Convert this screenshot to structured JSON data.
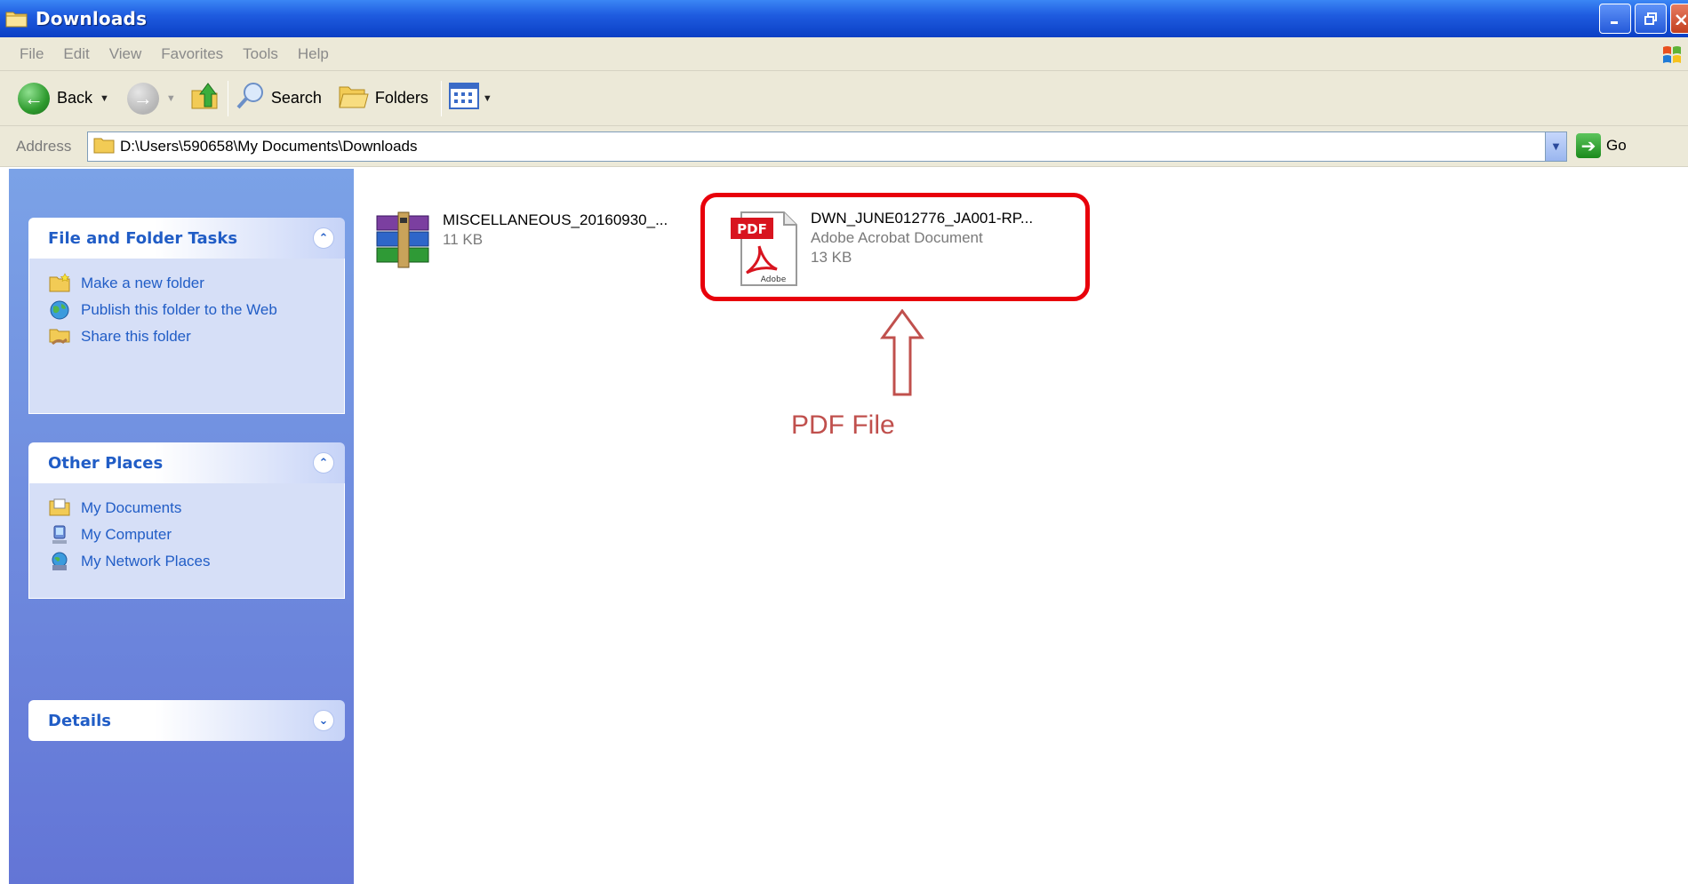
{
  "window": {
    "title": "Downloads"
  },
  "menu": [
    "File",
    "Edit",
    "View",
    "Favorites",
    "Tools",
    "Help"
  ],
  "toolbar": {
    "back_label": "Back",
    "search_label": "Search",
    "folders_label": "Folders"
  },
  "address": {
    "label": "Address",
    "path": "D:\\Users\\590658\\My Documents\\Downloads",
    "go_label": "Go"
  },
  "sidebar": {
    "file_tasks": {
      "title": "File and Folder Tasks",
      "items": [
        "Make a new folder",
        "Publish this folder to the Web",
        "Share this folder"
      ]
    },
    "other_places": {
      "title": "Other Places",
      "items": [
        "My Documents",
        "My Computer",
        "My Network Places"
      ]
    },
    "details": {
      "title": "Details"
    }
  },
  "files": [
    {
      "name": "MISCELLANEOUS_20160930_...",
      "type": "",
      "size": "11 KB",
      "icon": "winrar-archive-icon"
    },
    {
      "name": "DWN_JUNE012776_JA001-RP...",
      "type": "Adobe Acrobat Document",
      "size": "13 KB",
      "icon": "pdf-file-icon"
    }
  ],
  "annotation": {
    "label": "PDF File",
    "color": "#c0504d",
    "box_color": "#e8000b"
  }
}
